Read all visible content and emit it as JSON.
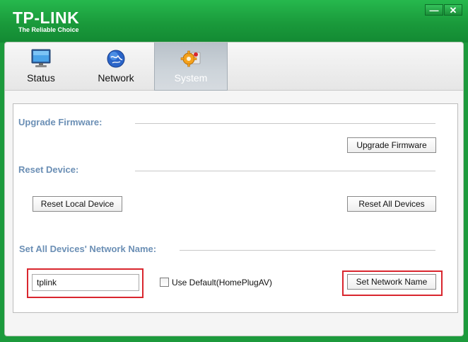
{
  "header": {
    "brand": "TP-LINK",
    "tagline": "The Reliable Choice",
    "minimize_glyph": "—",
    "close_glyph": "✕"
  },
  "tabs": [
    {
      "label": "Status",
      "icon": "monitor-icon",
      "active": false
    },
    {
      "label": "Network",
      "icon": "globe-icon",
      "active": false
    },
    {
      "label": "System",
      "icon": "gears-icon",
      "active": true
    }
  ],
  "system": {
    "upgrade": {
      "section_label": "Upgrade Firmware:",
      "button_label": "Upgrade Firmware"
    },
    "reset": {
      "section_label": "Reset Device:",
      "local_button": "Reset Local Device",
      "all_button": "Reset All Devices"
    },
    "network_name": {
      "section_label": "Set All Devices' Network Name:",
      "input_value": "tplink",
      "use_default_label": "Use Default(HomePlugAV)",
      "use_default_checked": false,
      "set_button": "Set Network Name"
    }
  },
  "colors": {
    "brand_green": "#1a9a3b",
    "section_label": "#6b8fb5",
    "highlight_red": "#d9262e",
    "active_tab": "#c3cbd2"
  }
}
